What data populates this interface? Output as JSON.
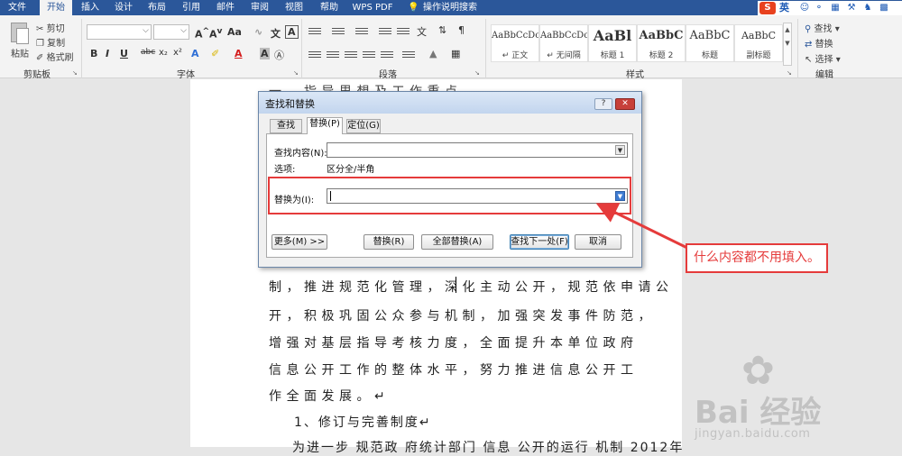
{
  "tabs": [
    {
      "label": "文件",
      "active": false
    },
    {
      "label": "开始",
      "active": true
    },
    {
      "label": "插入",
      "active": false
    },
    {
      "label": "设计",
      "active": false
    },
    {
      "label": "布局",
      "active": false
    },
    {
      "label": "引用",
      "active": false
    },
    {
      "label": "邮件",
      "active": false
    },
    {
      "label": "审阅",
      "active": false
    },
    {
      "label": "视图",
      "active": false
    },
    {
      "label": "帮助",
      "active": false
    },
    {
      "label": "WPS PDF",
      "active": false
    }
  ],
  "tell_me": "操作说明搜索",
  "ime": {
    "language": "英",
    "icons": [
      "smile-icon",
      "microphone-icon",
      "keyboard-icon",
      "tools-icon",
      "shirt-icon",
      "grid-icon"
    ]
  },
  "ribbon": {
    "clipboard": {
      "paste": "粘贴",
      "cut": "剪切",
      "copy": "复制",
      "format_painter": "格式刷",
      "label": "剪贴板"
    },
    "font": {
      "label": "字体",
      "font_name": "",
      "font_size": "",
      "buttons": [
        "B",
        "I",
        "U",
        "abc",
        "x₂",
        "x²",
        "A",
        "A",
        "A",
        "A",
        "Aa",
        "A",
        "A"
      ]
    },
    "paragraph": {
      "label": "段落"
    },
    "styles": {
      "label": "样式",
      "items": [
        {
          "sample": "AaBbCcDc",
          "name": "↵ 正文"
        },
        {
          "sample": "AaBbCcDc",
          "name": "↵ 无间隔"
        },
        {
          "sample": "AaBl",
          "name": "标题 1"
        },
        {
          "sample": "AaBbC",
          "name": "标题 2"
        },
        {
          "sample": "AaBbC",
          "name": "标题"
        },
        {
          "sample": "AaBbC",
          "name": "副标题"
        }
      ]
    },
    "editing": {
      "find": "查找",
      "replace": "替换",
      "select": "选择",
      "label": "编辑"
    }
  },
  "document": {
    "lines": [
      "制，推进规范化管理，深化主动公开，规范依申请公",
      "开，积极巩固公众参与机制，加强突发事件防范，",
      "增强对基层指导考核力度，全面提升本单位政府",
      "信息公开工作的整体水平，努力推进信息公开工",
      "作全面发展。↵",
      "1、修订与完善制度↵",
      "为进一步 规范政 府统计部门 信息 公开的运行 机制 2012年"
    ],
    "background_heading": "一、指导思想及工作重点"
  },
  "dialog": {
    "title": "查找和替换",
    "tabs": [
      {
        "label": "查找(D)",
        "active": false
      },
      {
        "label": "替换(P)",
        "active": true
      },
      {
        "label": "定位(G)",
        "active": false
      }
    ],
    "find_label": "查找内容(N):",
    "find_value": "",
    "options_label": "选项:",
    "options_value": "区分全/半角",
    "replace_label": "替换为(I):",
    "replace_value": "",
    "buttons": {
      "more": "更多(M) >>",
      "replace": "替换(R)",
      "replace_all": "全部替换(A)",
      "find_next": "查找下一处(F)",
      "cancel": "取消"
    },
    "help": "?",
    "close": "✕"
  },
  "annotation": {
    "text": "什么内容都不用填入。",
    "color": "#e53b3b"
  },
  "watermark": {
    "brand": "Bai 经验",
    "url": "jingyan.baidu.com"
  },
  "colors": {
    "accent": "#2b579a",
    "annotation": "#e53b3b",
    "ime_red": "#e8411e"
  }
}
